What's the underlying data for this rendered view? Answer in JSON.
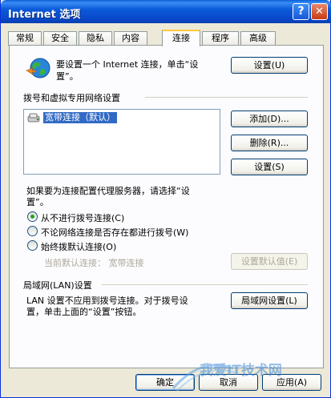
{
  "window": {
    "title": "Internet 选项",
    "help_glyph": "?",
    "close_glyph": "✕"
  },
  "tabs": [
    {
      "label": "常规"
    },
    {
      "label": "安全"
    },
    {
      "label": "隐私"
    },
    {
      "label": "内容"
    },
    {
      "label": "连接"
    },
    {
      "label": "程序"
    },
    {
      "label": "高级"
    }
  ],
  "setup": {
    "text_line1": "要设置一个 Internet 连接，单击“设",
    "text_line2": "置”。",
    "button": "设置(U)"
  },
  "dialup": {
    "section_title": "拨号和虚拟专用网络设置",
    "connections": [
      "宽带连接（默认）"
    ],
    "add_button": "添加(D)...",
    "remove_button": "删除(R)...",
    "settings_button": "设置(S)"
  },
  "proxy_hint": {
    "line1": "如果要为连接配置代理服务器，请选择“设",
    "line2": "置”。"
  },
  "dial_options": [
    {
      "label": "从不进行拨号连接(C)",
      "selected": true
    },
    {
      "label": "不论网络连接是否存在都进行拨号(W)",
      "selected": false
    },
    {
      "label": "始终拨默认连接(O)",
      "selected": false
    }
  ],
  "default_connection": {
    "label": "当前默认连接：  宽带连接",
    "button": "设置默认值(E)"
  },
  "lan": {
    "section_title": "局域网(LAN)设置",
    "text_line1": "LAN 设置不应用到拨号连接。对于拨号设",
    "text_line2": "置，单击上面的“设置”按钮。",
    "button": "局域网设置(L)"
  },
  "footer": {
    "ok": "确定",
    "cancel": "取消",
    "apply": "应用(A)"
  },
  "watermark_text": "我爱IT技术网",
  "colors": {
    "title_bar": "#0a5fd6",
    "dialog_bg": "#ece9d8",
    "selection": "#316ac5",
    "active_tab_accent": "#ffc83c"
  }
}
